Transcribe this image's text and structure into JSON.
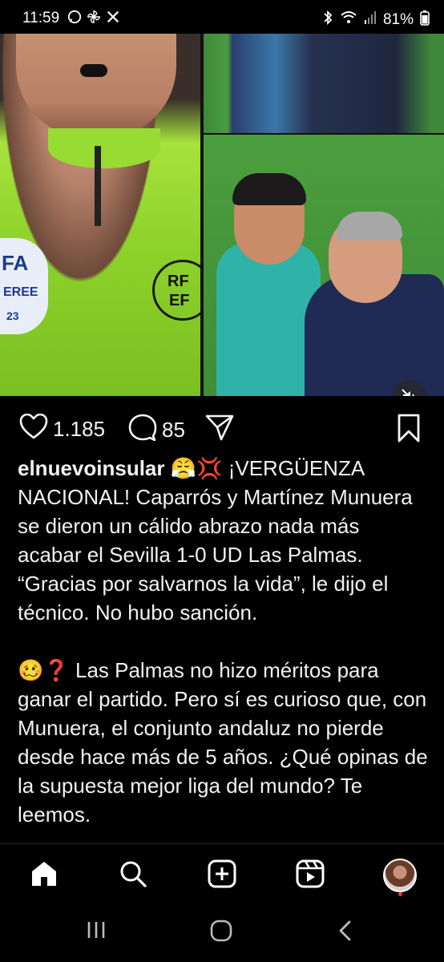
{
  "status_bar": {
    "time": "11:59",
    "left_icons": [
      "whatsapp-icon",
      "pinwheel-icon",
      "x-icon"
    ],
    "right_icons": [
      "bluetooth-icon",
      "wifi-icon",
      "signal-icon"
    ],
    "battery": "81%"
  },
  "post": {
    "media": {
      "left_badge_text": "FA\nEREE\n23",
      "right_badge_text": "RF\nEF",
      "mute_icon": "speaker-muted-icon"
    },
    "actions": {
      "likes": "1.185",
      "comments": "85"
    },
    "caption": {
      "username": "elnuevoinsular",
      "emojis_1": "😤💢",
      "paragraph_1": "¡VERGÜENZA NACIONAL! Caparrós y Martínez Munuera se dieron un cálido abrazo nada más acabar el Sevilla 1-0 UD Las Palmas. “Gracias por salvarnos la vida”, le dijo el técnico. No hubo sanción.",
      "emojis_2": "🥴❓",
      "paragraph_2": "Las Palmas no hizo méritos para ganar el partido. Pero sí es curioso que, con Munuera, el conjunto andaluz no pierde desde hace más de 5 años. ¿Qué opinas de la supuesta mejor liga del mundo? Te leemos."
    }
  },
  "bottom_nav": [
    "home-icon",
    "search-icon",
    "create-icon",
    "reels-icon",
    "profile-avatar"
  ],
  "colors": {
    "background": "#000000",
    "text": "#f5f5f5",
    "referee_shirt": "#a6e23c",
    "notification": "#ff3040"
  }
}
